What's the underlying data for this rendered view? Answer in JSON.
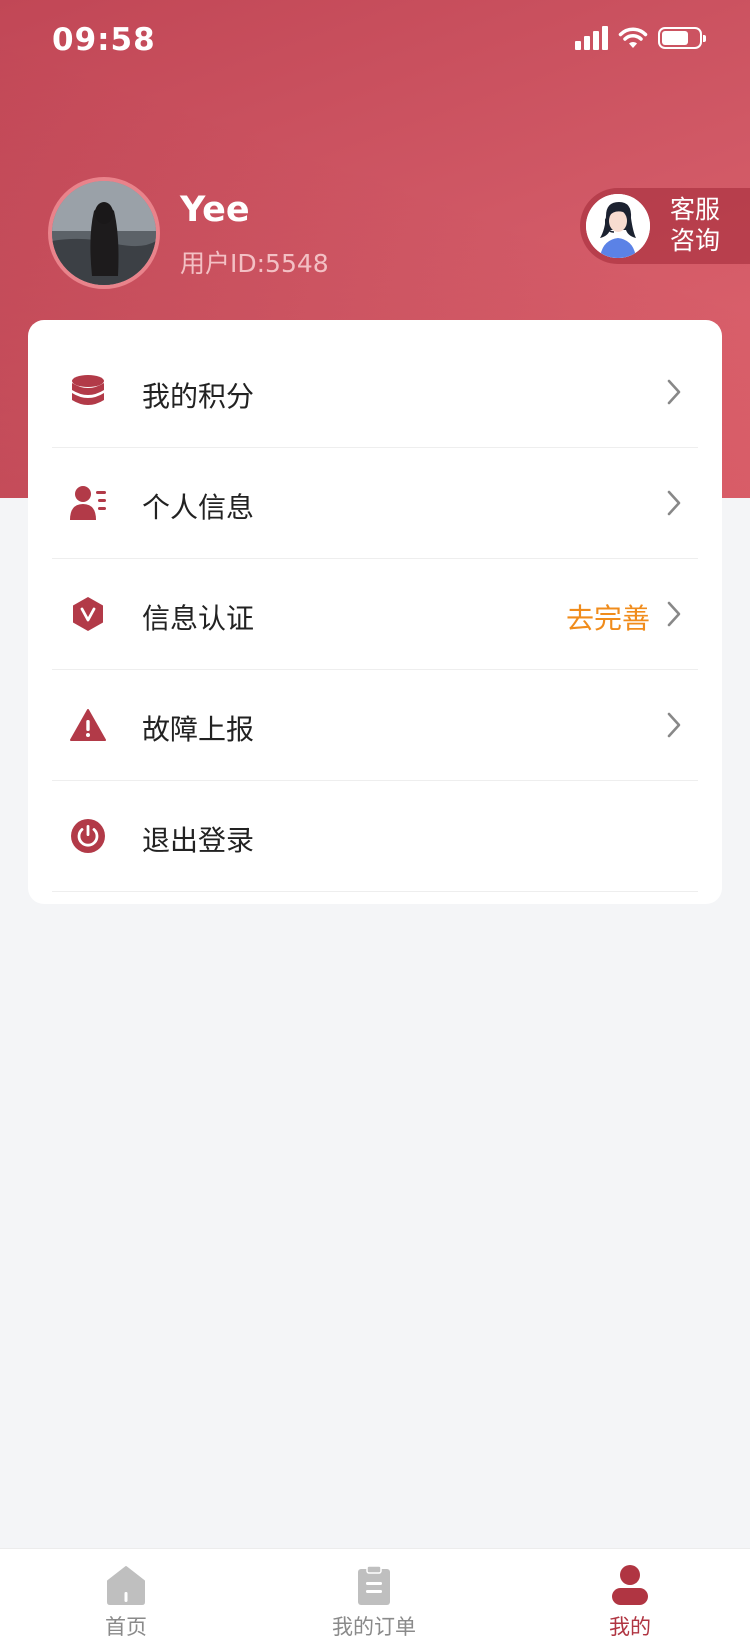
{
  "status_bar": {
    "time": "09:58"
  },
  "profile": {
    "username": "Yee",
    "user_id": "用户ID:5548",
    "customer_service_label_line1": "客服",
    "customer_service_label_line2": "咨询"
  },
  "menu": {
    "items": [
      {
        "label": "我的积分",
        "icon": "coins-stack-icon",
        "hint": "",
        "has_chevron": true
      },
      {
        "label": "个人信息",
        "icon": "person-info-icon",
        "hint": "",
        "has_chevron": true
      },
      {
        "label": "信息认证",
        "icon": "verified-hexagon-icon",
        "hint": "去完善",
        "has_chevron": true
      },
      {
        "label": "故障上报",
        "icon": "warning-triangle-icon",
        "hint": "",
        "has_chevron": true
      },
      {
        "label": "退出登录",
        "icon": "power-icon",
        "hint": "",
        "has_chevron": false
      }
    ]
  },
  "tabbar": {
    "tabs": [
      {
        "label": "首页",
        "icon": "home-icon",
        "active": false
      },
      {
        "label": "我的订单",
        "icon": "clipboard-icon",
        "active": false
      },
      {
        "label": "我的",
        "icon": "user-icon",
        "active": true
      }
    ]
  },
  "colors": {
    "accent": "#b03542",
    "hint": "#f08c1c",
    "header_start": "#c14756",
    "header_end": "#e0646e"
  }
}
